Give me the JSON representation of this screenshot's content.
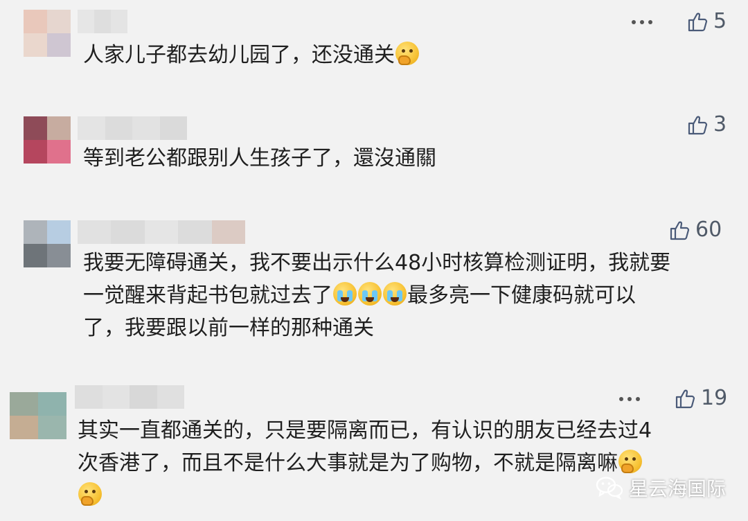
{
  "comments": [
    {
      "text_lines": [
        "人家儿子都去幼儿园了，还没通关"
      ],
      "emoji_after": "think",
      "likes": "5",
      "has_more_menu": true,
      "avatar_colors": [
        "#e9c8bb",
        "#e6d6cf",
        "#ead7cd",
        "#cfc6d2"
      ],
      "name_colors": [
        "#e6e6e6",
        "#dedede",
        "#e4e4e4"
      ]
    },
    {
      "text_lines": [
        "等到老公都跟别人生孩子了，還沒通關"
      ],
      "likes": "3",
      "has_more_menu": false,
      "avatar_colors": [
        "#8e4b58",
        "#c7aca0",
        "#b5465e",
        "#e0718c"
      ],
      "name_colors": [
        "#e4e4e4",
        "#dcdcdc",
        "#e2e2e2",
        "#dadada"
      ]
    },
    {
      "text_lines": [
        "我要无障碍通关，我不要出示什么48小时核算检测证明，我就要",
        "一觉醒来背起书包就过去了",
        "最多亮一下健康码就可以",
        "了，我要跟以前一样的那种通关"
      ],
      "likes": "60",
      "has_more_menu": false,
      "avatar_colors": [
        "#aeb4ba",
        "#b7cde2",
        "#6e7479",
        "#888e95"
      ],
      "name_colors": [
        "#e1e1e1",
        "#dbdbdb",
        "#e5e5e5",
        "#dcdcdc",
        "#dccbc4"
      ]
    },
    {
      "text_lines": [
        "其实一直都通关的，只是要隔离而已，有认识的朋友已经去过4",
        "次香港了，而且不是什么大事就是为了购物，不就是隔离嘛"
      ],
      "likes": "19",
      "has_more_menu": true,
      "avatar_colors": [
        "#9aa99a",
        "#8fb3ad",
        "#c5ad93",
        "#9ab6ad"
      ],
      "name_colors": [
        "#dedede",
        "#e3e3e3",
        "#d8d8d8",
        "#e0e0e0"
      ]
    }
  ],
  "watermark": {
    "icon": "wechat-icon",
    "text": "星云海国际"
  },
  "colors": {
    "background": "#f2f2f2",
    "text": "#1f1f1f",
    "like_icon": "#4a5a78"
  }
}
